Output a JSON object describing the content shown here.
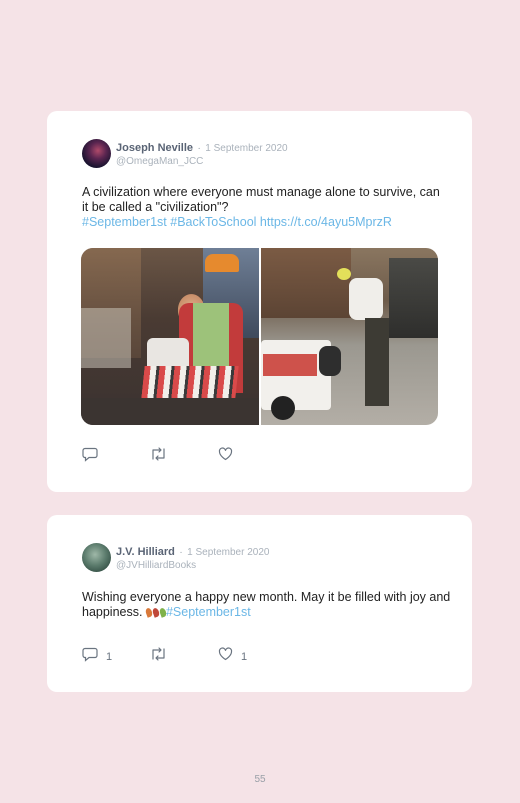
{
  "tweets": [
    {
      "author": "Joseph Neville",
      "separator": "·",
      "date": "1 September 2020",
      "handle": "@OmegaMan_JCC",
      "text": "A civilization where everyone must manage alone to survive, can it be called a \"civilization\"?",
      "hashtag1": "#September1st",
      "hashtag2": "#BackToSchool",
      "link": "https://t.co/4ayu5MprzR",
      "replies": "",
      "retweets": "",
      "likes": ""
    },
    {
      "author": "J.V. Hilliard",
      "separator": "·",
      "date": "1 September 2020",
      "handle": "@JVHilliardBooks",
      "text": "Wishing everyone a happy new month. May it be filled with joy and happiness.",
      "hashtag1": "#September1st",
      "replies": "1",
      "retweets": "",
      "likes": "1"
    }
  ],
  "icons": {
    "reply": "reply-icon",
    "retweet": "retweet-icon",
    "like": "heart-icon"
  },
  "colors": {
    "background": "#f5e3e7",
    "card": "#ffffff",
    "hashtag": "#6bb7e6"
  },
  "page_number": "55"
}
